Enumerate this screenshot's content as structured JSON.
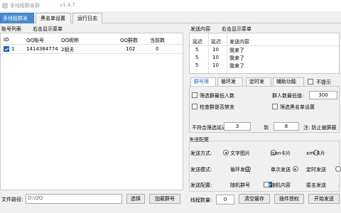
{
  "window": {
    "title": "多线程群发群",
    "version": "v1.4.7"
  },
  "tabs": [
    "多线程群发群",
    "黑名单设置",
    "运行日志"
  ],
  "left": {
    "section_label": "账号列表",
    "context_hint": "右击显示菜单",
    "columns": [
      "ID",
      "QQ账号",
      "QQ昵称",
      "QQ群数",
      "当前数"
    ],
    "rows": [
      {
        "checked": true,
        "id": "1",
        "qq": "1414384774",
        "nick": "2姐夫",
        "groups": "102",
        "current": "0"
      }
    ],
    "path_label": "文件路径:",
    "path_value": "D:\\QQ",
    "choose_button": "选择",
    "load_button": "加载群号"
  },
  "send": {
    "section_label": "发送内容",
    "context_hint": "右击显示菜单",
    "columns": [
      "延迟",
      "延迟",
      "发送内容"
    ],
    "rows": [
      {
        "a": "5",
        "b": "10",
        "text": "我来了"
      },
      {
        "a": "5",
        "b": "10",
        "text": "我来了"
      },
      {
        "a": "5",
        "b": "10",
        "text": "我来了"
      }
    ]
  },
  "mid_tabs": [
    "群号筛选",
    "循环发送",
    "定时发送",
    "辅助功能"
  ],
  "no_tip_label": "不提示",
  "filter": {
    "min_members": "筛选群最低人数",
    "min_members_value_label": "群人数最低值:",
    "min_members_value": "300",
    "check_banned": "检查群是否禁言",
    "blacklist": "筛选黑名单设置",
    "delay_label": "不符合筛选延迟:",
    "delay_from": "3",
    "to_label": "到",
    "delay_to": "8",
    "note": "注: 防止被屏蔽"
  },
  "config": {
    "section_label": "发送配置",
    "mode_label": "发送方式:",
    "modes": [
      "文字图片",
      "json卡片",
      "xml卡片"
    ],
    "style_label": "发送模式:",
    "styles": [
      "循环发送",
      "单次发送",
      "定时发送"
    ],
    "setting_label": "发送配置:",
    "settings": [
      "随机群号",
      "随机内容",
      "匿名发送"
    ],
    "thread_label": "线程数量:",
    "thread_value": "0",
    "clear_button": "清空缓存",
    "plugin_button": "插件授权",
    "start_button": "开始发送"
  }
}
